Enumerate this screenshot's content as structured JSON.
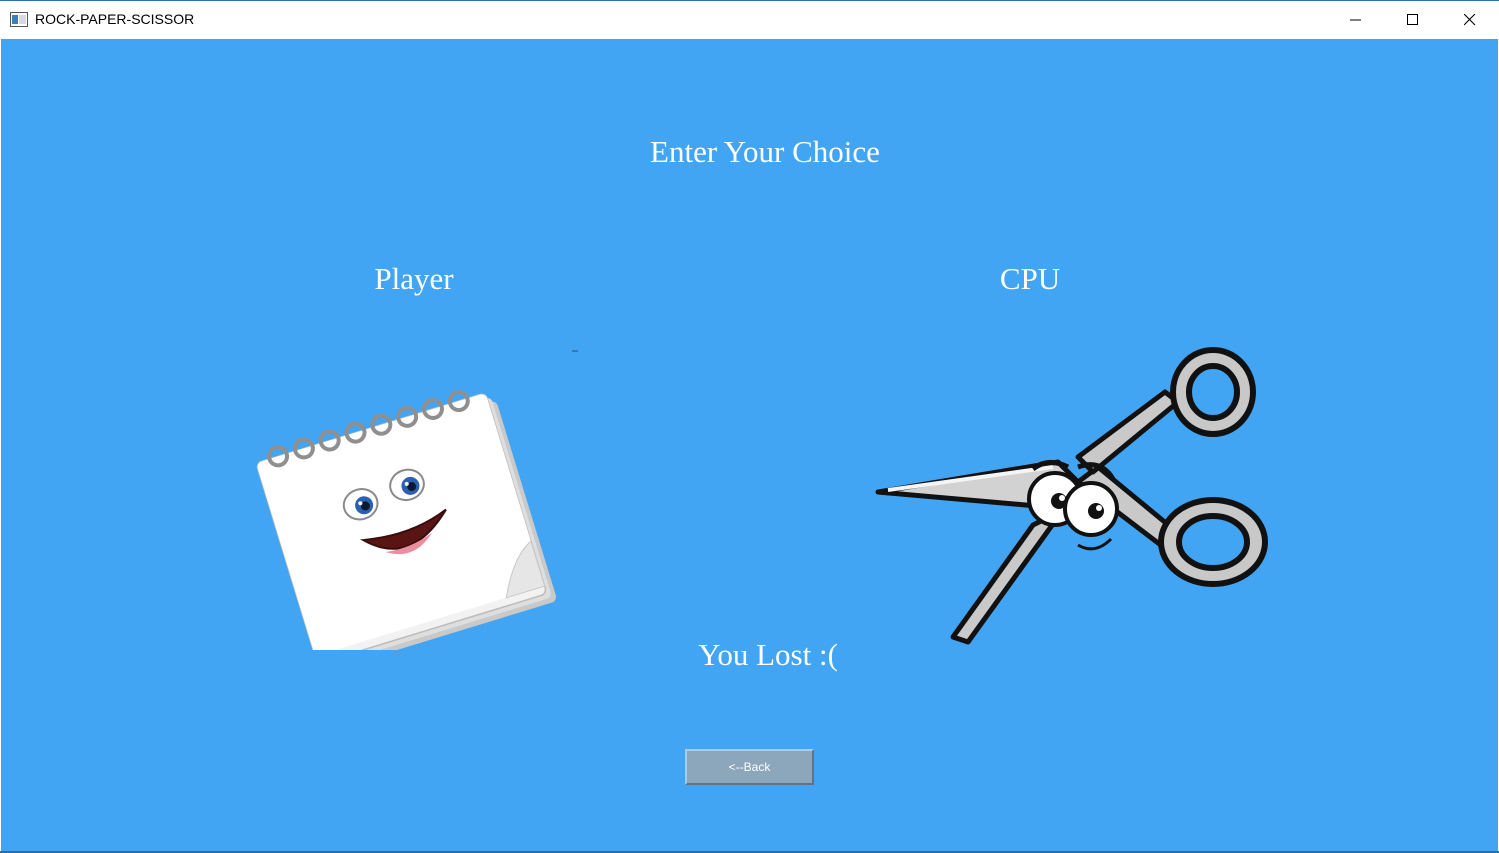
{
  "window": {
    "title": "ROCK-PAPER-SCISSOR",
    "icons": [
      "app-icon",
      "minimize-icon",
      "maximize-icon",
      "close-icon"
    ]
  },
  "game": {
    "heading": "Enter Your Choice",
    "player_label": "Player",
    "cpu_label": "CPU",
    "player_choice": "paper",
    "cpu_choice": "scissors",
    "result": "You Lost :(",
    "back_label": "<--Back"
  },
  "colors": {
    "background": "#42a5f3",
    "button": "#8ca6bb",
    "text": "#ffffff"
  }
}
